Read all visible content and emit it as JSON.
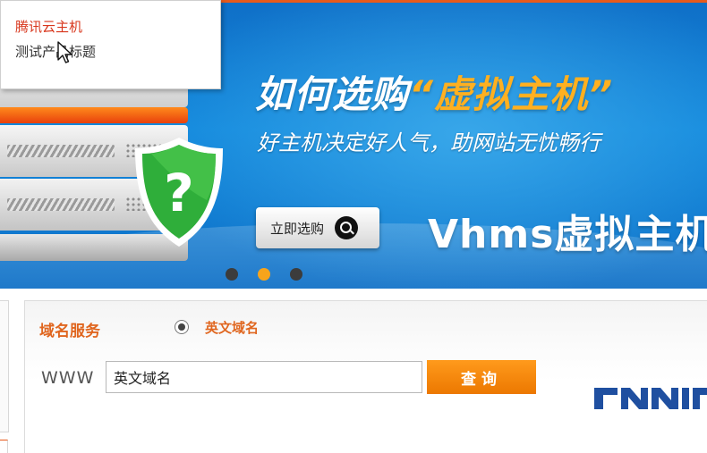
{
  "dropdown": {
    "item_active": "腾讯云主机",
    "item_hover": "测试产品标题"
  },
  "banner": {
    "headline_prefix": "如何选购",
    "headline_highlight": "“虚拟主机”",
    "subline": "好主机决定好人气，助网站无忧畅行",
    "buy_button": "立即选购",
    "brand": "Vhms虚拟主机",
    "slides": [
      false,
      true,
      false
    ],
    "shield_symbol": "?"
  },
  "domain": {
    "title": "域名服务",
    "radio_label": "英文域名",
    "prefix": "WWW",
    "input_value": "英文域名",
    "query_button": "查询",
    "logo_text": "CNNIC"
  },
  "colors": {
    "accent_orange": "#e0661f",
    "button_orange": "#ff8c0a",
    "banner_blue": "#1288dc",
    "highlight_gold": "#ffb020"
  }
}
